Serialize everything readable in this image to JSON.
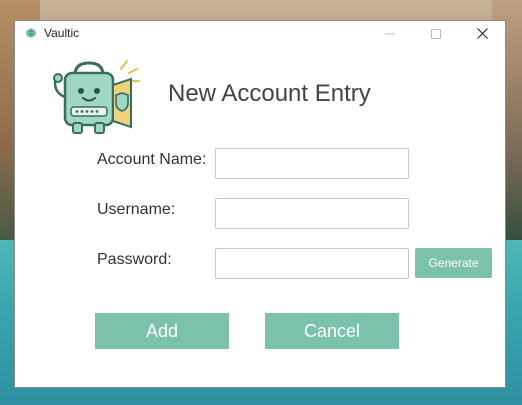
{
  "window": {
    "title": "Vaultic",
    "icon": "brain-icon"
  },
  "window_controls": {
    "minimize_icon": "minimize-icon",
    "maximize_icon": "maximize-icon",
    "close_icon": "close-icon"
  },
  "form": {
    "heading": "New Account Entry",
    "mascot": "vault-mascot-illustration",
    "fields": {
      "account_name": {
        "label": "Account Name:",
        "value": ""
      },
      "username": {
        "label": "Username:",
        "value": ""
      },
      "password": {
        "label": "Password:",
        "value": ""
      }
    },
    "generate_label": "Generate",
    "add_label": "Add",
    "cancel_label": "Cancel"
  },
  "colors": {
    "accent": "#7cc1ab",
    "heading_text": "#444444"
  }
}
